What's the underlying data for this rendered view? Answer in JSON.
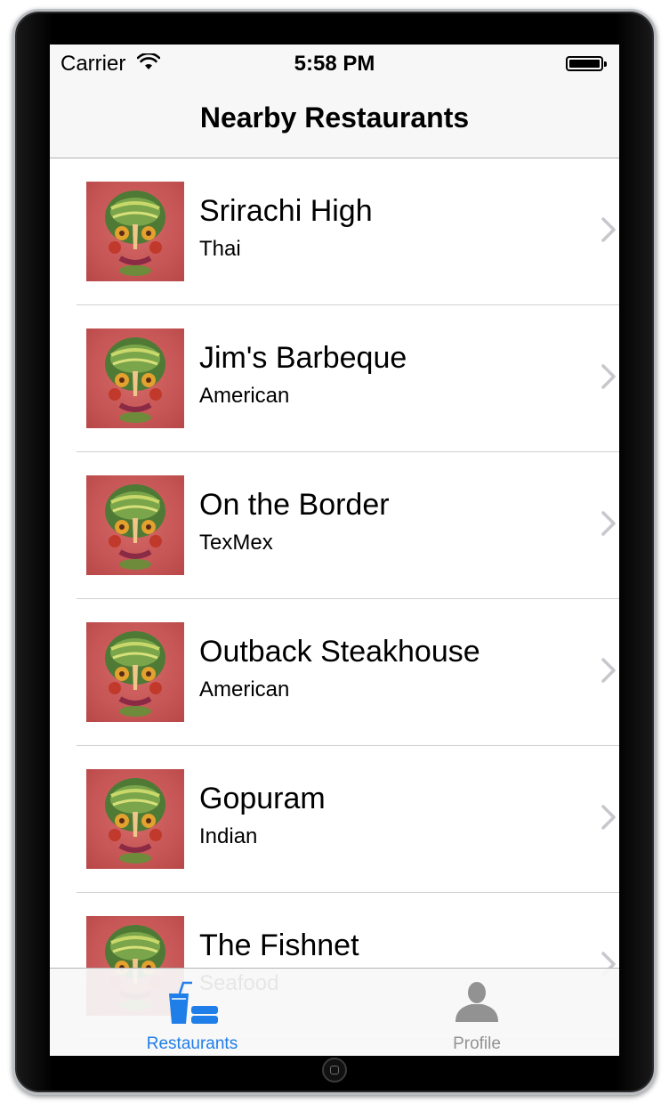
{
  "status_bar": {
    "carrier": "Carrier",
    "time": "5:58 PM"
  },
  "nav": {
    "title": "Nearby Restaurants"
  },
  "restaurants": [
    {
      "name": "Srirachi High",
      "cuisine": "Thai"
    },
    {
      "name": "Jim's Barbeque",
      "cuisine": "American"
    },
    {
      "name": "On the Border",
      "cuisine": "TexMex"
    },
    {
      "name": "Outback Steakhouse",
      "cuisine": "American"
    },
    {
      "name": "Gopuram",
      "cuisine": "Indian"
    },
    {
      "name": "The Fishnet",
      "cuisine": "Seafood"
    }
  ],
  "tab_bar": {
    "tabs": [
      {
        "label": "Restaurants",
        "icon": "drinks-icon",
        "selected": true
      },
      {
        "label": "Profile",
        "icon": "person-icon",
        "selected": false
      }
    ]
  },
  "colors": {
    "accent": "#1f7ee8",
    "inactive": "#929292",
    "thumb_bg": "#c75656"
  }
}
